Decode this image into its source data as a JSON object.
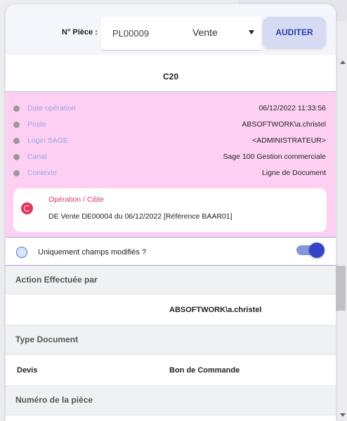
{
  "header": {
    "piece_label": "N° Pièce :",
    "piece_value": "PL00009",
    "type_value": "Vente",
    "audit_button": "AUDITER"
  },
  "code": "C20",
  "info": [
    {
      "label": "Date opération",
      "value": "06/12/2022 11:33:56"
    },
    {
      "label": "Poste",
      "value": "ABSOFTWORK\\a.christel"
    },
    {
      "label": "Login SAGE",
      "value": "<ADMINISTRATEUR>"
    },
    {
      "label": "Canal",
      "value": "Sage 100 Gestion commerciale"
    },
    {
      "label": "Contexte",
      "value": "Ligne de Document"
    }
  ],
  "operation": {
    "title": "Opération / Cible",
    "description": "DE Vente DE00004 du 06/12/2022 [Référence BAAR01]"
  },
  "toggle": {
    "label": "Uniquement champs modifiés ?",
    "checked": true
  },
  "sections": {
    "action_header": "Action Effectuée par",
    "action_value": "ABSOFTWORK\\a.christel",
    "type_header": "Type Document",
    "type_old": "Devis",
    "type_new": "Bon de Commande",
    "numero_header": "Numéro de la pièce"
  },
  "colors": {
    "pink_bg": "#fdd0f3",
    "accent": "#3344c8",
    "button_bg": "#d6dbf3",
    "label_blue": "#9aa3e8",
    "op_red": "#e5335a"
  },
  "icons": {
    "dropdown": "chevron-down-icon",
    "operation": "refresh-target-icon",
    "status_dot": "dot-icon"
  }
}
